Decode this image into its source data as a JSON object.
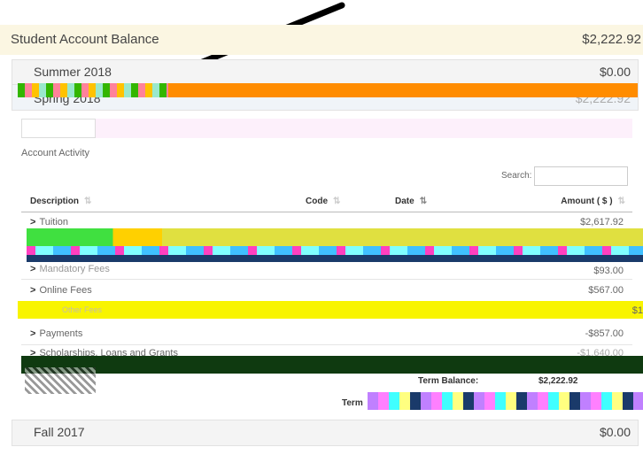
{
  "balance": {
    "title": "Student Account Balance",
    "amount": "$2,222.92"
  },
  "terms": {
    "summer": {
      "label": "Summer 2018",
      "amount": "$0.00"
    },
    "spring": {
      "label": "Spring 2018",
      "amount": "$2,222.92"
    },
    "fall": {
      "label": "Fall 2017",
      "amount": "$0.00"
    }
  },
  "activity": {
    "title": "Account Activity",
    "search_label": "Search:",
    "search_placeholder": "",
    "columns": {
      "description": "Description",
      "code": "Code",
      "date": "Date",
      "amount": "Amount ( $ )"
    },
    "rows": [
      {
        "desc": "Tuition",
        "amount": "$2,617.92"
      },
      {
        "desc": "Mandatory Fees",
        "amount": "$93.00"
      },
      {
        "desc": "Online Fees",
        "amount": "$567.00"
      },
      {
        "desc": "Other Fees",
        "amount": "$1"
      },
      {
        "desc": "Payments",
        "amount": "-$857.00"
      },
      {
        "desc": "Scholarships, Loans and Grants",
        "amount": "-$1,640.00"
      }
    ],
    "term_balance_label": "Term Balance:",
    "term_balance_value": "$2,222.92",
    "term_footer": "Term"
  },
  "colors": {
    "arrow": "#000000",
    "glitch_orange": "#ff8c00",
    "glitch_yellow": "#ffff00",
    "glitch_green": "#00ff00"
  }
}
